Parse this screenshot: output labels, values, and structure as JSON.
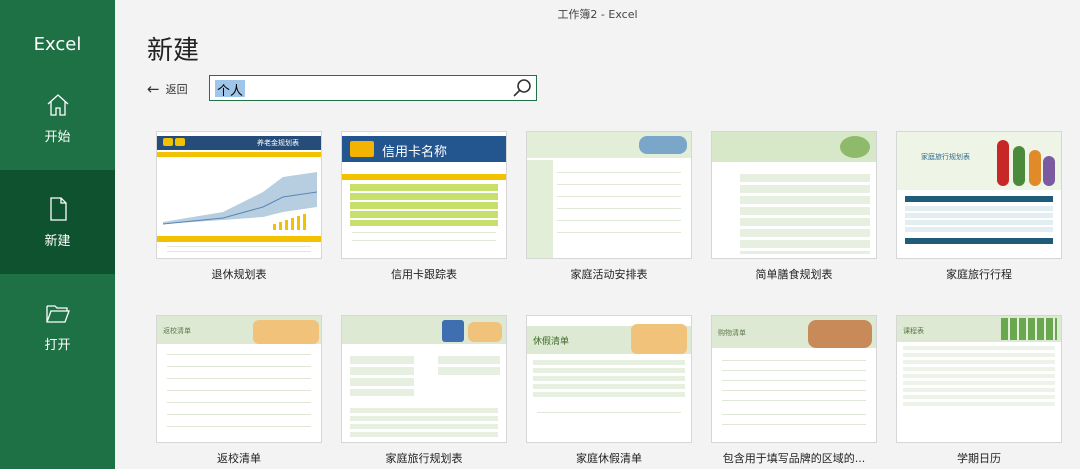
{
  "window": {
    "title": "工作簿2  -  Excel"
  },
  "rail": {
    "brand": "Excel",
    "items": [
      {
        "label": "开始",
        "icon": "home-icon",
        "active": false
      },
      {
        "label": "新建",
        "icon": "new-document-icon",
        "active": true
      },
      {
        "label": "打开",
        "icon": "open-folder-icon",
        "active": false
      }
    ]
  },
  "main": {
    "title": "新建",
    "back_label": "返回",
    "search": {
      "value": "个人",
      "icon": "search-icon"
    }
  },
  "templates": [
    {
      "label": "退休规划表",
      "thumb_title": "养老金规划表"
    },
    {
      "label": "信用卡跟踪表",
      "thumb_title": "信用卡名称"
    },
    {
      "label": "家庭活动安排表",
      "thumb_title": ""
    },
    {
      "label": "简单膳食规划表",
      "thumb_title": ""
    },
    {
      "label": "家庭旅行行程",
      "thumb_title": "家庭旅行规划表"
    },
    {
      "label": "返校清单",
      "thumb_title": "返校清单"
    },
    {
      "label": "家庭旅行规划表",
      "thumb_title": ""
    },
    {
      "label": "家庭休假清单",
      "thumb_title": "休假清单"
    },
    {
      "label": "包含用于填写品牌的区域的...",
      "thumb_title": "购物清单"
    },
    {
      "label": "学期日历",
      "thumb_title": "课程表"
    }
  ],
  "colors": {
    "accent": "#1e7145",
    "rail_active": "#0f5230",
    "search_border": "#217346"
  }
}
